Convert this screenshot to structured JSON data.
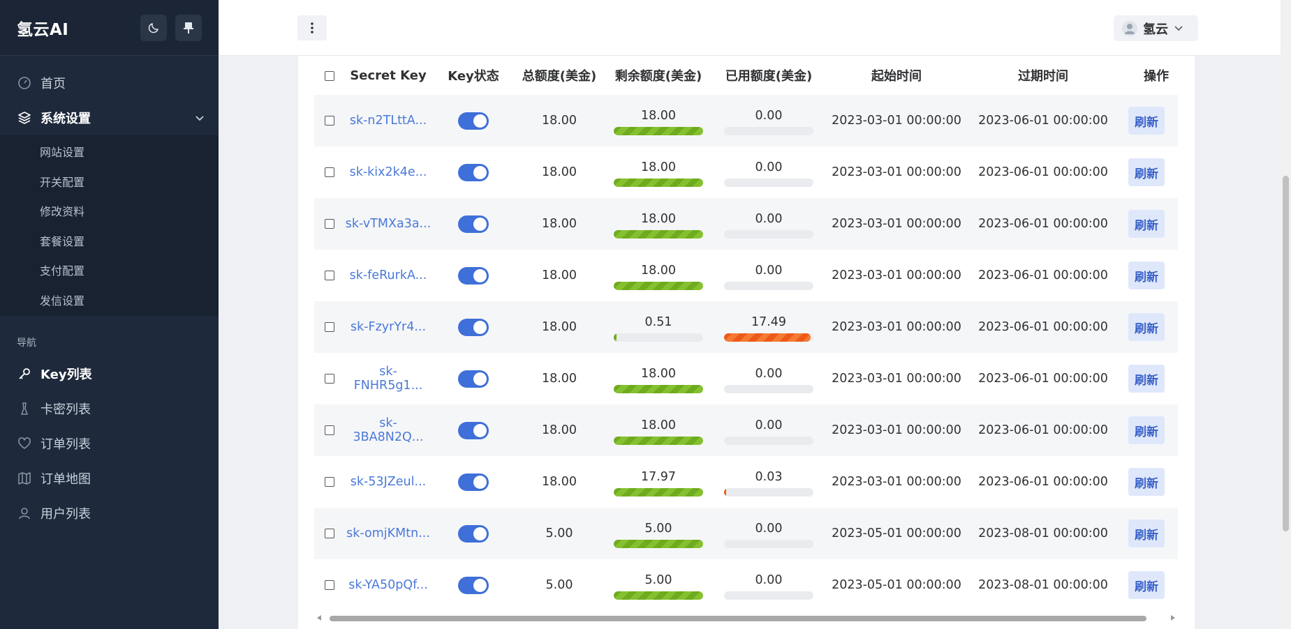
{
  "sidebar": {
    "brand": "氢云AI",
    "menu": [
      {
        "label": "首页"
      },
      {
        "label": "系统设置"
      }
    ],
    "submenu": [
      {
        "label": "网站设置"
      },
      {
        "label": "开关配置"
      },
      {
        "label": "修改资料"
      },
      {
        "label": "套餐设置"
      },
      {
        "label": "支付配置"
      },
      {
        "label": "发信设置"
      }
    ],
    "section_title": "导航",
    "nav": [
      {
        "label": "Key列表",
        "icon": "key-icon"
      },
      {
        "label": "卡密列表",
        "icon": "ticket-icon"
      },
      {
        "label": "订单列表",
        "icon": "heart-icon"
      },
      {
        "label": "订单地图",
        "icon": "map-icon"
      },
      {
        "label": "用户列表",
        "icon": "user-icon"
      }
    ]
  },
  "header": {
    "user_name": "氢云"
  },
  "table": {
    "columns": [
      "Secret Key",
      "Key状态",
      "总额度(美金)",
      "剩余额度(美金)",
      "已用额度(美金)",
      "起始时间",
      "过期时间",
      "操作"
    ],
    "action_label": "刷新",
    "rows": [
      {
        "key": "sk-n2TLttA...",
        "enabled": true,
        "total": "18.00",
        "remaining": "18.00",
        "remaining_frac": 1.0,
        "used": "0.00",
        "used_frac": 0.0,
        "start": "2023-03-01 00:00:00",
        "expire": "2023-06-01 00:00:00"
      },
      {
        "key": "sk-kix2k4e...",
        "enabled": true,
        "total": "18.00",
        "remaining": "18.00",
        "remaining_frac": 1.0,
        "used": "0.00",
        "used_frac": 0.0,
        "start": "2023-03-01 00:00:00",
        "expire": "2023-06-01 00:00:00"
      },
      {
        "key": "sk-vTMXa3a...",
        "enabled": true,
        "total": "18.00",
        "remaining": "18.00",
        "remaining_frac": 1.0,
        "used": "0.00",
        "used_frac": 0.0,
        "start": "2023-03-01 00:00:00",
        "expire": "2023-06-01 00:00:00"
      },
      {
        "key": "sk-feRurkA...",
        "enabled": true,
        "total": "18.00",
        "remaining": "18.00",
        "remaining_frac": 1.0,
        "used": "0.00",
        "used_frac": 0.0,
        "start": "2023-03-01 00:00:00",
        "expire": "2023-06-01 00:00:00"
      },
      {
        "key": "sk-FzyrYr4...",
        "enabled": true,
        "total": "18.00",
        "remaining": "0.51",
        "remaining_frac": 0.028,
        "used": "17.49",
        "used_frac": 0.972,
        "start": "2023-03-01 00:00:00",
        "expire": "2023-06-01 00:00:00"
      },
      {
        "key": "sk-FNHR5g1...",
        "enabled": true,
        "total": "18.00",
        "remaining": "18.00",
        "remaining_frac": 1.0,
        "used": "0.00",
        "used_frac": 0.0,
        "start": "2023-03-01 00:00:00",
        "expire": "2023-06-01 00:00:00"
      },
      {
        "key": "sk-3BA8N2Q...",
        "enabled": true,
        "total": "18.00",
        "remaining": "18.00",
        "remaining_frac": 1.0,
        "used": "0.00",
        "used_frac": 0.0,
        "start": "2023-03-01 00:00:00",
        "expire": "2023-06-01 00:00:00"
      },
      {
        "key": "sk-53JZeul...",
        "enabled": true,
        "total": "18.00",
        "remaining": "17.97",
        "remaining_frac": 0.998,
        "used": "0.03",
        "used_frac": 0.02,
        "start": "2023-03-01 00:00:00",
        "expire": "2023-06-01 00:00:00"
      },
      {
        "key": "sk-omjKMtn...",
        "enabled": true,
        "total": "5.00",
        "remaining": "5.00",
        "remaining_frac": 1.0,
        "used": "0.00",
        "used_frac": 0.0,
        "start": "2023-05-01 00:00:00",
        "expire": "2023-08-01 00:00:00"
      },
      {
        "key": "sk-YA50pQf...",
        "enabled": true,
        "total": "5.00",
        "remaining": "5.00",
        "remaining_frac": 1.0,
        "used": "0.00",
        "used_frac": 0.0,
        "start": "2023-05-01 00:00:00",
        "expire": "2023-08-01 00:00:00"
      }
    ]
  },
  "colors": {
    "sidebar_bg": "#1e293b",
    "accent": "#3f6fd8",
    "link": "#4b79d8",
    "remaining_bar": "#6eab1e",
    "used_bar": "#ed5a17"
  }
}
